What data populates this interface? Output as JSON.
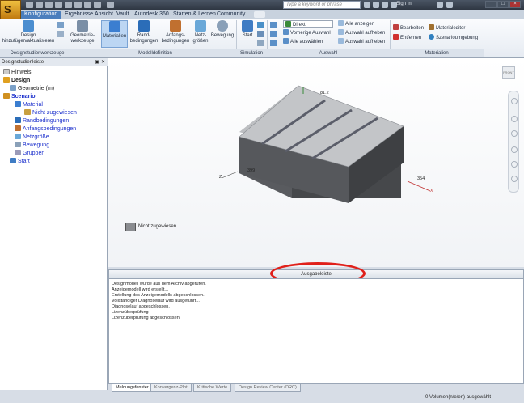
{
  "titlebar": {
    "search_placeholder": "Type a keyword or phrase",
    "signin": "Sign In"
  },
  "tabs": [
    "Konfiguration",
    "Ergebnisse",
    "Ansicht",
    "Vault",
    "Autodesk 360",
    "Starten & Lernen",
    "Community"
  ],
  "ribbon": {
    "design": "Design hinzufügen/aktualisieren",
    "geometrie": "Geometrie-werkzeuge",
    "materialien": "Materialien",
    "rand": "Rand-bedingungen",
    "anfangs": "Anfangs-bedingungen",
    "netz": "Netz-größen",
    "bewegung": "Bewegung",
    "start": "Start",
    "direkt": "Direkt",
    "alle_anzeigen": "Alle anzeigen",
    "vorherige": "Vorherige Auswahl",
    "auswahl_aufheben1": "Auswahl aufheben",
    "alle_auswaehlen": "Alle auswählen",
    "auswahl_aufheben2": "Auswahl aufheben",
    "bearbeiten": "Bearbeiten",
    "materialeditor": "Materialeditor",
    "entfernen": "Entfernen",
    "szenario": "Szenarioumgebung",
    "groups": {
      "dsw": "Designstudienwerkzeuge",
      "modell": "Modelldefinition",
      "sim": "Simulation",
      "auswahl": "Auswahl",
      "mat": "Materialien"
    }
  },
  "browser": {
    "title": "Designstudienleiste",
    "items": [
      "Hinweis",
      "Design",
      "Geometrie (m)",
      "Scenario",
      "Material",
      "Nicht zugewiesen",
      "Randbedingungen",
      "Anfangsbedingungen",
      "Netzgröße",
      "Bewegung",
      "Gruppen",
      "Start"
    ]
  },
  "viewport": {
    "dim_top": "81.2",
    "dim_left": "399",
    "dim_right": "354",
    "axis_x": "X",
    "axis_z": "Z",
    "legend": "Nicht zugewiesen",
    "viewcube": "FRONT"
  },
  "output": {
    "title": "Ausgabeleiste",
    "lines": [
      "Designmodell wurde aus dem Archiv abgerufen.",
      "Anzeigemodell wird erstellt...",
      "Erstellung des Anzeigemodells abgeschlossen.",
      "Vollständiger Diagnoselauf wird ausgeführt...",
      "Diagnoselauf abgeschlossen.",
      "Lizenzüberprüfung",
      "Lizenzüberprüfung abgeschlossen"
    ],
    "tabs": [
      "Meldungsfenster",
      "Konvergenz-Plot",
      "Kritische Werte",
      "Design Review Center (DRC)"
    ]
  },
  "status": "0 Volumen(n/e/en) ausgewählt",
  "colors": {
    "accent": "#4b7ebd",
    "highlight": "#e0201a",
    "link": "#1a2ecc"
  }
}
